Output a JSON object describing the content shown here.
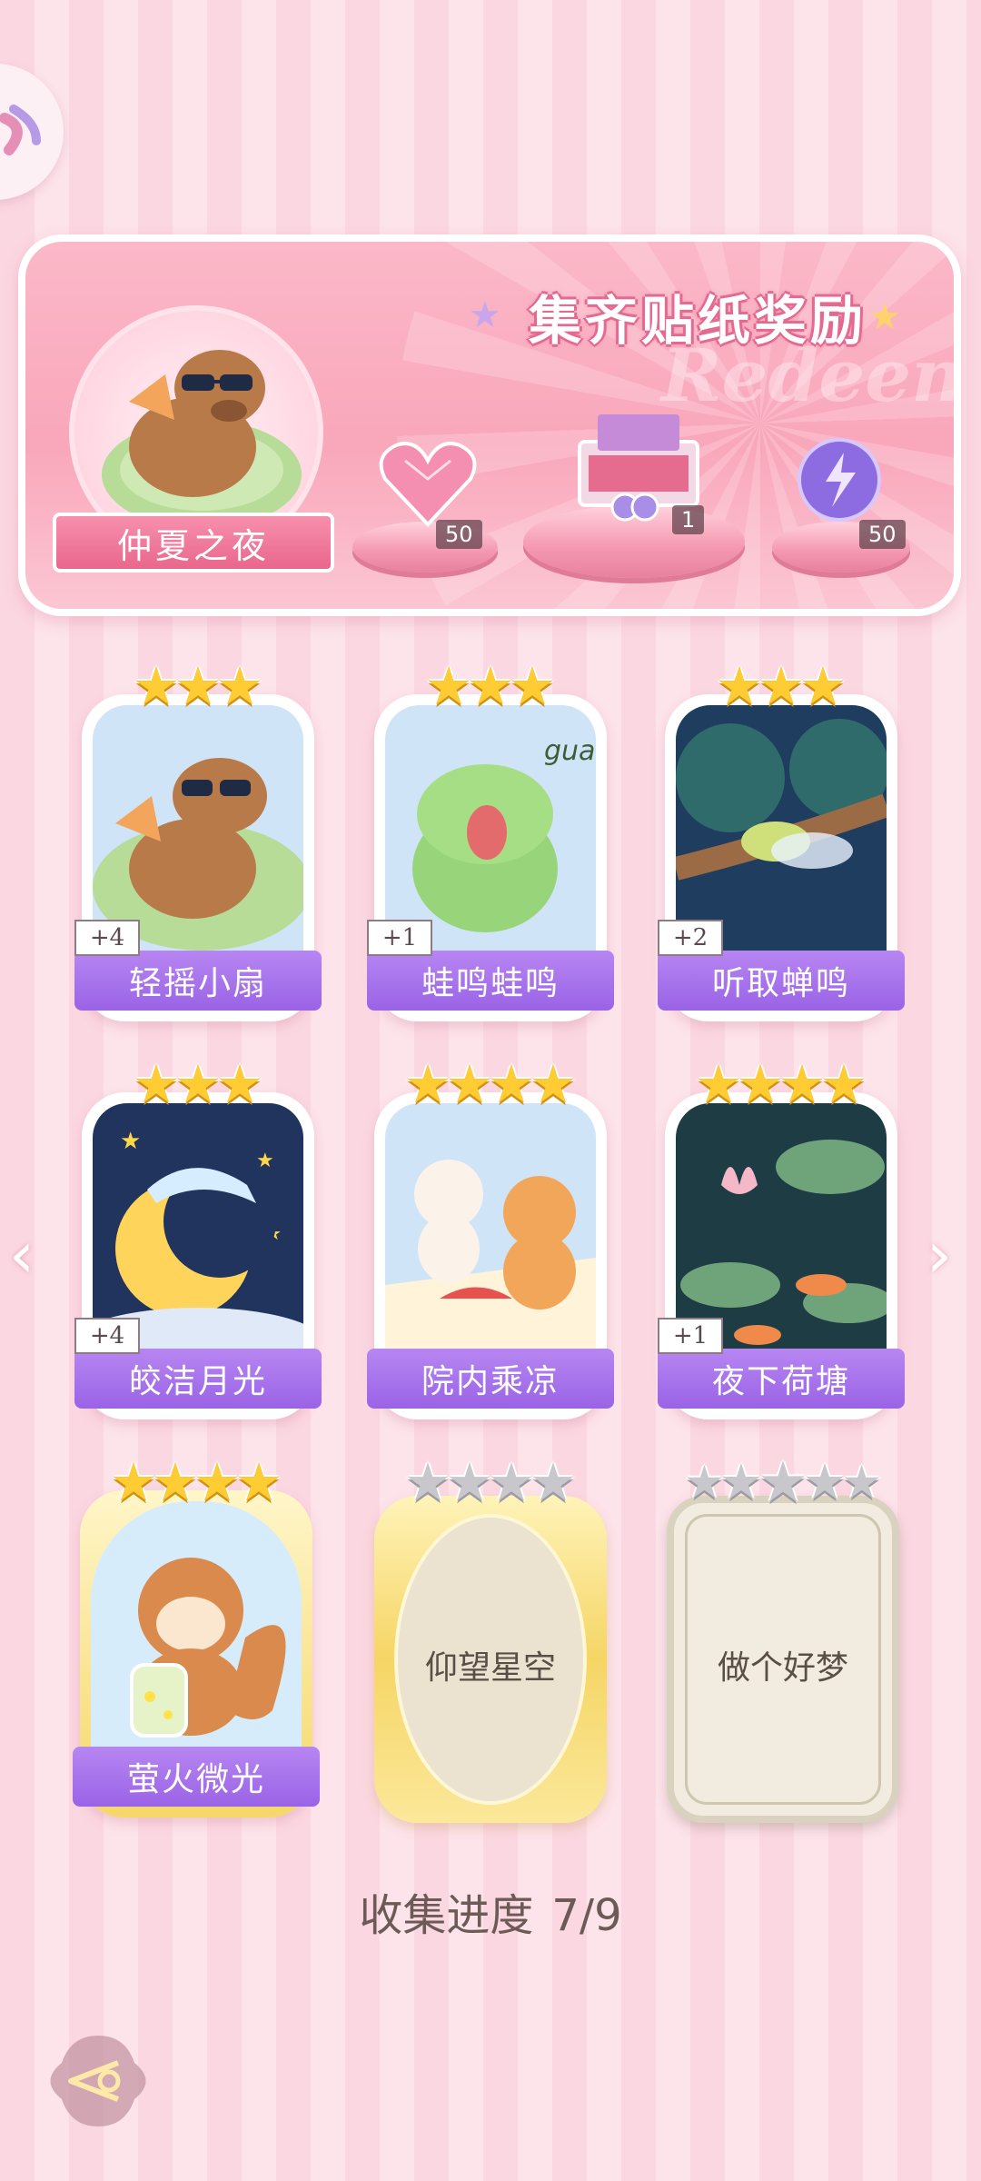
{
  "banner": {
    "title": "集齐贴纸奖励",
    "watermark": "Redeem",
    "hero_name": "仲夏之夜",
    "rewards": [
      {
        "icon": "pink-heart-gem-icon",
        "qty": "50"
      },
      {
        "icon": "gift-box-icon",
        "qty": "1"
      },
      {
        "icon": "purple-energy-orb-icon",
        "qty": "50"
      }
    ]
  },
  "cards": [
    {
      "name": "轻摇小扇",
      "stars": 3,
      "max_stars": 3,
      "badge": "+4",
      "art": "capybara-fan"
    },
    {
      "name": "蛙鸣蛙鸣",
      "stars": 3,
      "max_stars": 3,
      "badge": "+1",
      "art": "frog",
      "art_text": "gua"
    },
    {
      "name": "听取蝉鸣",
      "stars": 3,
      "max_stars": 3,
      "badge": "+2",
      "art": "cicada"
    },
    {
      "name": "皎洁月光",
      "stars": 3,
      "max_stars": 3,
      "badge": "+4",
      "art": "moon"
    },
    {
      "name": "院内乘凉",
      "stars": 4,
      "max_stars": 4,
      "badge": "",
      "art": "cats-picnic"
    },
    {
      "name": "夜下荷塘",
      "stars": 4,
      "max_stars": 4,
      "badge": "+1",
      "art": "lotus-pond"
    },
    {
      "name": "萤火微光",
      "stars": 4,
      "max_stars": 4,
      "badge": "",
      "art": "squirrel-jar"
    },
    {
      "name": "仰望星空",
      "stars": 0,
      "max_stars": 4,
      "badge": "",
      "art": "locked-gold"
    },
    {
      "name": "做个好梦",
      "stars": 0,
      "max_stars": 5,
      "badge": "",
      "art": "locked-silver"
    }
  ],
  "progress": {
    "label": "收集进度",
    "value": "7/9",
    "collected": 7,
    "total": 9
  },
  "colors": {
    "accent": "#9a63e6",
    "banner": "#f9a7bb",
    "gold_star": "#ffcc33"
  }
}
